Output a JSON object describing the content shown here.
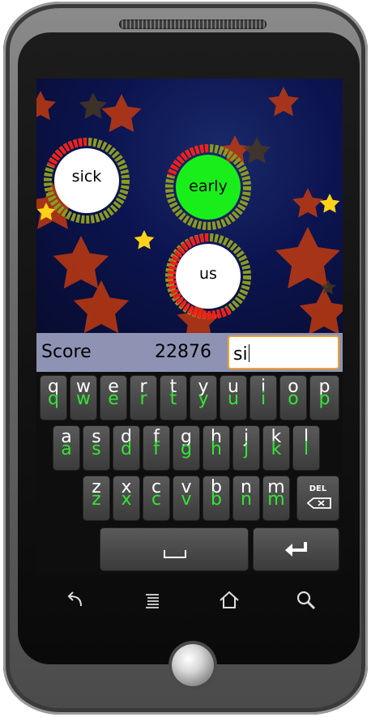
{
  "game": {
    "words": [
      {
        "text": "sick",
        "state": "normal"
      },
      {
        "text": "early",
        "state": "highlighted"
      },
      {
        "text": "us",
        "state": "normal"
      }
    ],
    "colors": {
      "ring_red": "#ff1a1a",
      "ring_green": "#8a9a22",
      "highlight": "#1aee1a",
      "sky": "#0c1450"
    }
  },
  "score": {
    "label": "Score",
    "value": "22876"
  },
  "input": {
    "value": "si"
  },
  "keyboard": {
    "row1": [
      {
        "main": "q",
        "alt": "q"
      },
      {
        "main": "w",
        "alt": "w"
      },
      {
        "main": "e",
        "alt": "e"
      },
      {
        "main": "r",
        "alt": "r"
      },
      {
        "main": "t",
        "alt": "t"
      },
      {
        "main": "y",
        "alt": "y"
      },
      {
        "main": "u",
        "alt": "u"
      },
      {
        "main": "i",
        "alt": "i"
      },
      {
        "main": "o",
        "alt": "o"
      },
      {
        "main": "p",
        "alt": "p"
      }
    ],
    "row2": [
      {
        "main": "a",
        "alt": "a"
      },
      {
        "main": "s",
        "alt": "s"
      },
      {
        "main": "d",
        "alt": "d"
      },
      {
        "main": "f",
        "alt": "f"
      },
      {
        "main": "g",
        "alt": "g"
      },
      {
        "main": "h",
        "alt": "h"
      },
      {
        "main": "j",
        "alt": "j"
      },
      {
        "main": "k",
        "alt": "k"
      },
      {
        "main": "l",
        "alt": "l"
      }
    ],
    "row3": [
      {
        "main": "z",
        "alt": "z"
      },
      {
        "main": "x",
        "alt": "x"
      },
      {
        "main": "c",
        "alt": "c"
      },
      {
        "main": "v",
        "alt": "v"
      },
      {
        "main": "b",
        "alt": "b"
      },
      {
        "main": "n",
        "alt": "n"
      },
      {
        "main": "m",
        "alt": "m"
      }
    ],
    "del_label": "DEL",
    "icons": {
      "space": "space-bar-icon",
      "enter": "enter-arrow-icon",
      "delete": "backspace-icon"
    }
  },
  "navbar": {
    "icons": [
      "back-arrow-icon",
      "menu-icon",
      "home-icon",
      "search-icon"
    ]
  }
}
